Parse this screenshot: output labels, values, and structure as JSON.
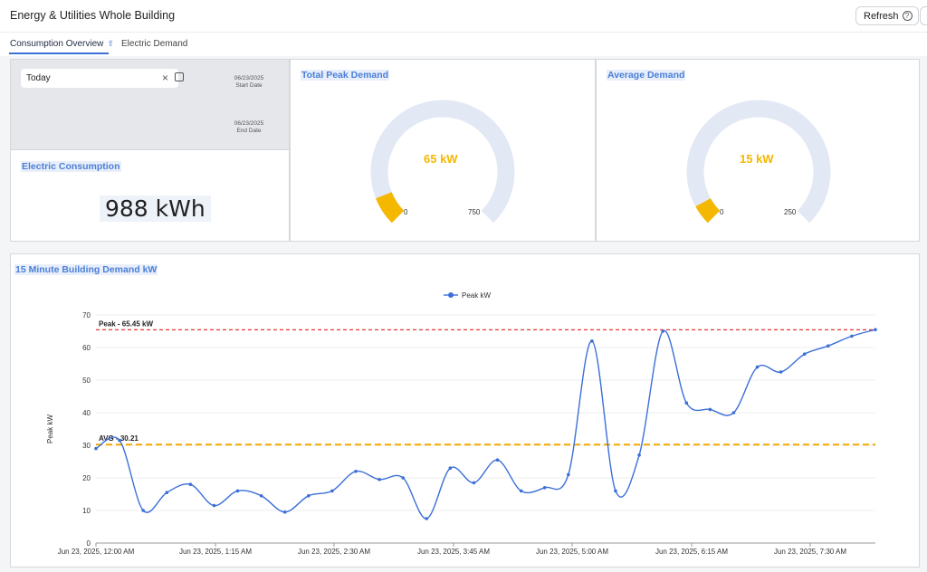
{
  "header": {
    "title": "Energy & Utilities Whole Building",
    "refresh_label": "Refresh"
  },
  "tabs": [
    {
      "label": "Consumption Overview",
      "active": true
    },
    {
      "label": "Electric Demand",
      "active": false
    }
  ],
  "date_filter": {
    "value": "Today",
    "start_date": "06/23/2025",
    "start_label": "Start Date",
    "end_date": "06/23/2025",
    "end_label": "End Date"
  },
  "electric_consumption": {
    "title": "Electric Consumption",
    "value": "988 kWh"
  },
  "total_peak_demand": {
    "title": "Total Peak Demand",
    "value_label": "65 kW",
    "value": 65,
    "min": 0,
    "max": 750
  },
  "average_demand": {
    "title": "Average Demand",
    "value_label": "15 kW",
    "value": 15,
    "min": 0,
    "max": 250
  },
  "colors": {
    "accent": "#3b6fd8",
    "gauge_fill": "#f5b800",
    "gauge_track": "#e3e8f5",
    "peak_line": "#e53935",
    "avg_line": "#f5a800"
  },
  "chart_data": {
    "type": "line",
    "title": "15 Minute Building Demand kW",
    "ylabel": "Peak kW",
    "xlabel": "",
    "ylim": [
      0,
      70
    ],
    "yticks": [
      0,
      10,
      20,
      30,
      40,
      50,
      60,
      70
    ],
    "legend": "top-center",
    "x_tick_labels": [
      "Jun 23, 2025, 12:00 AM",
      "Jun 23, 2025, 1:15 AM",
      "Jun 23, 2025, 2:30 AM",
      "Jun 23, 2025, 3:45 AM",
      "Jun 23, 2025, 5:00 AM",
      "Jun 23, 2025, 6:15 AM",
      "Jun 23, 2025, 7:30 AM"
    ],
    "series": [
      {
        "name": "Peak kW",
        "values": [
          29,
          31.5,
          10,
          15.5,
          18,
          11.5,
          16,
          14.5,
          9.5,
          14.5,
          16,
          22,
          19.5,
          20,
          7.5,
          23,
          18.5,
          25.5,
          16,
          17,
          21,
          62,
          16,
          27,
          65,
          43,
          41,
          40,
          54,
          52.5,
          58,
          60.5,
          63.5,
          65.5
        ]
      }
    ],
    "reference_lines": [
      {
        "label": "Peak - 65.45 kW",
        "value": 65.45
      },
      {
        "label": "AVG - 30.21",
        "value": 30.21
      }
    ]
  }
}
